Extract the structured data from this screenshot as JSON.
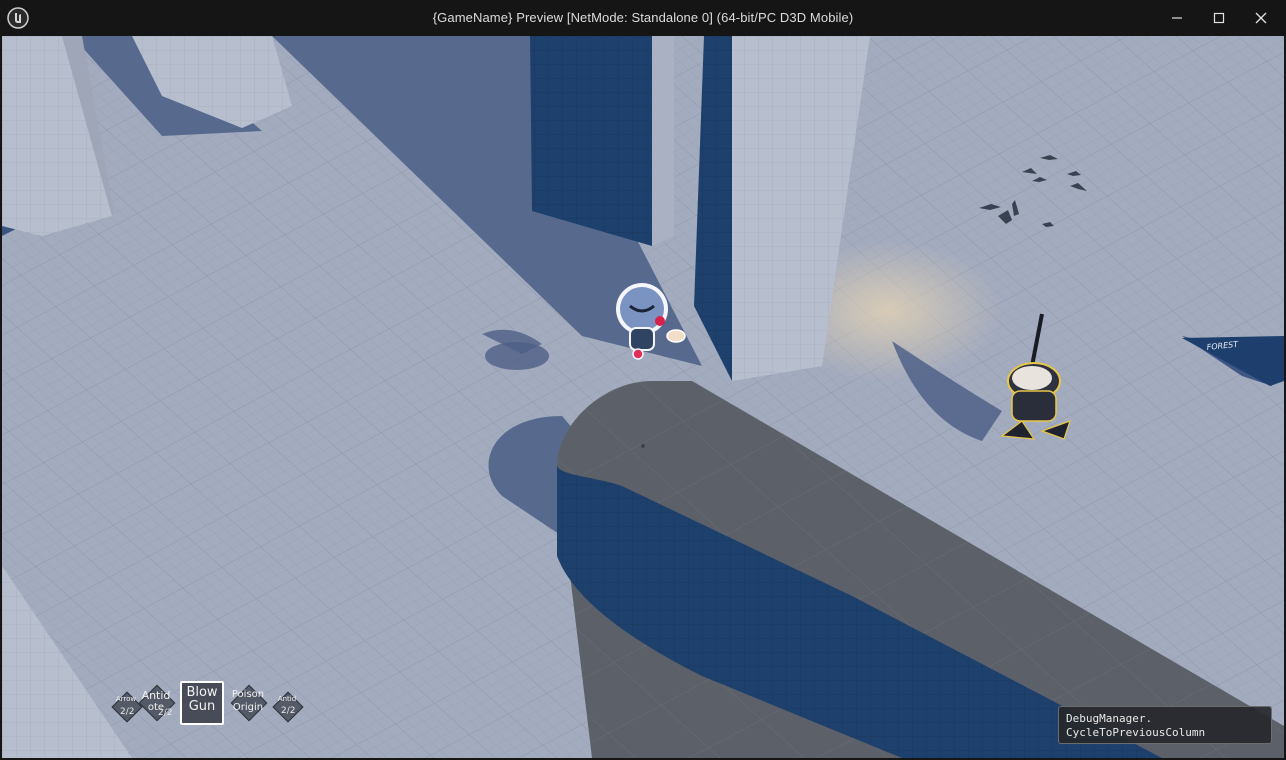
{
  "window": {
    "title": "{GameName} Preview [NetMode: Standalone 0]  (64-bit/PC D3D Mobile)",
    "controls": {
      "minimize": "minimize-icon",
      "maximize": "maximize-icon",
      "close": "close-icon"
    }
  },
  "scene": {
    "sign_text": "FOREST"
  },
  "hud": {
    "slots": [
      {
        "label": "Arrow",
        "count": "2/2"
      },
      {
        "label": "Antidote",
        "count": "2/2"
      },
      {
        "label": "Blow Gun",
        "count": "",
        "selected": true
      },
      {
        "label": "Poison Origin",
        "count": ""
      },
      {
        "label": "Antid",
        "count": "2/2"
      }
    ],
    "selected_line1": "Blow",
    "selected_line2": "Gun",
    "slot1_line1": "Arrow",
    "slot1_count": "2/2",
    "slot2_line1": "Antid",
    "slot2_line2": "ote",
    "slot2_count": "2/2",
    "slot4_line1": "Poison",
    "slot4_line2": "Origin",
    "slot5_line1": "Antid",
    "slot5_count": "2/2"
  },
  "debug": {
    "line1": "DebugManager.",
    "line2": "CycleToPreviousColumn"
  },
  "colors": {
    "floor": "#a3abbe",
    "wall_dark": "#1b3f6e",
    "wall_light": "#b9c1d1",
    "ramp_top": "#5a5e66",
    "accent_yellow": "#e8c64a"
  }
}
